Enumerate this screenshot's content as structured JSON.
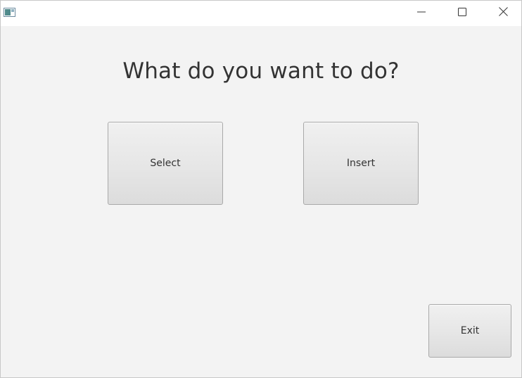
{
  "window": {
    "icon": "app-window-icon",
    "controls": {
      "minimize_icon": "minimize-icon",
      "maximize_icon": "maximize-icon",
      "close_icon": "close-icon"
    }
  },
  "main": {
    "heading": "What do you want to do?",
    "select_label": "Select",
    "insert_label": "Insert",
    "exit_label": "Exit"
  },
  "colors": {
    "background": "#f3f3f3",
    "titlebar": "#ffffff",
    "button_border": "#a9a9a9",
    "text": "#333333"
  }
}
